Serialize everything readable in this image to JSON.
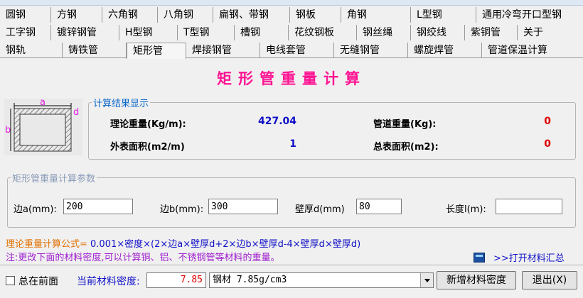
{
  "tabs": {
    "row1": [
      "圆钢",
      "方钢",
      "六角钢",
      "八角钢",
      "扁钢、带钢",
      "钢板",
      "角钢",
      "L型钢",
      "通用冷弯开口型钢"
    ],
    "row2": [
      "工字钢",
      "镀锌钢管",
      "H型钢",
      "T型钢",
      "槽钢",
      "花纹钢板",
      "钢丝绳",
      "钢绞线",
      "紫铜管",
      "关于"
    ],
    "row3": [
      "钢轨",
      "铸铁管",
      "矩形管",
      "焊接钢管",
      "电线套管",
      "无缝钢管",
      "螺旋焊管",
      "管道保温计算"
    ],
    "active": "矩形管"
  },
  "main": {
    "title": "矩形管重量计算",
    "diagram": {
      "label_a": "a",
      "label_b": "b",
      "label_d": "d"
    }
  },
  "results": {
    "group_title": "计算结果显示",
    "theoretical_weight_label": "理论重量(Kg/m):",
    "theoretical_weight_value": "427.04",
    "pipe_weight_label": "管道重量(Kg):",
    "pipe_weight_value": "0",
    "outer_area_label": "外表面积(m2/m)",
    "outer_area_value": "1",
    "total_area_label": "总表面积(m2):",
    "total_area_value": "0"
  },
  "params": {
    "group_title": "矩形管重量计算参数",
    "side_a_label": "边a(mm):",
    "side_a_value": "200",
    "side_b_label": "边b(mm):",
    "side_b_value": "300",
    "wall_label": "壁厚d(mm)",
    "wall_value": "80",
    "length_label": "长度l(m):",
    "length_value": ""
  },
  "formula": {
    "prefix": "理论重量计算公式= ",
    "expression": "0.001×密度×(2×边a×壁厚d+2×边b×壁厚d-4×壁厚d×壁厚d)"
  },
  "note": "注:更改下面的材料密度,可以计算铜、铝、不锈钢管等材料的重量。",
  "open_summary_label": ">>打开材料汇总",
  "bottom": {
    "always_on_top_label": "总在前面",
    "density_label": "当前材料密度:",
    "density_value": "7.85",
    "material_selected": "钢材 7.85g/cm3",
    "add_density_button": "新增材料密度",
    "exit_button": "退出(X)"
  },
  "colors": {
    "title": "#ff1493",
    "result_value_blue": "#1010c8",
    "result_value_red": "#e00000",
    "formula": "#e07000",
    "note": "#a020d0"
  }
}
